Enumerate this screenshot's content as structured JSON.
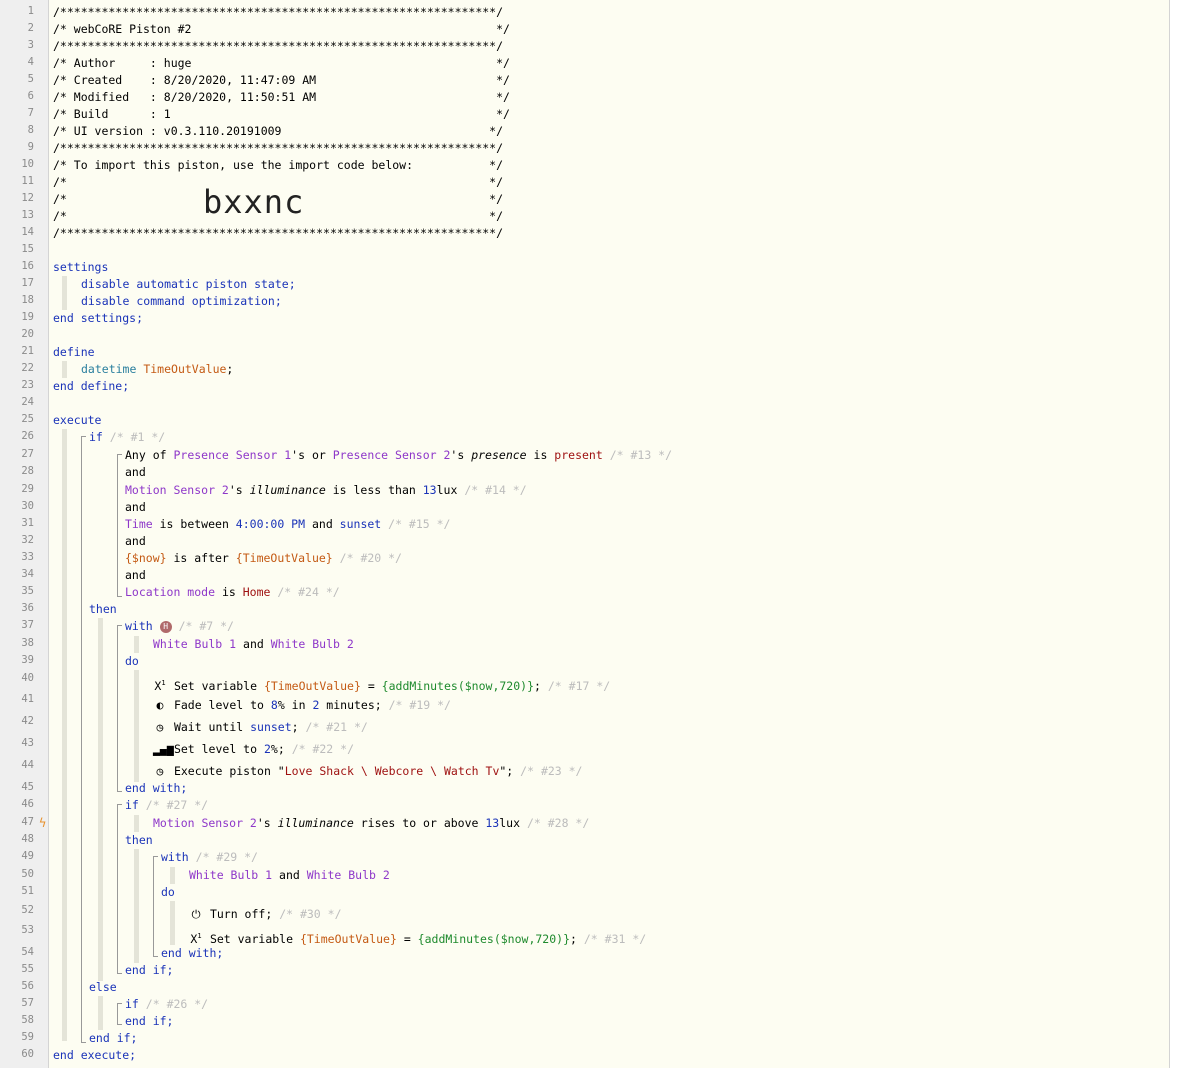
{
  "import_code": "bxxnc",
  "header": {
    "stars": "/***************************************************************/",
    "title": "/* webCoRE Piston #2                                            */",
    "author": "/* Author     : huge                                            */",
    "created": "/* Created    : 8/20/2020, 11:47:09 AM                          */",
    "modified": "/* Modified   : 8/20/2020, 11:50:51 AM                          */",
    "build": "/* Build      : 1                                               */",
    "ui_version": "/* UI version : v0.3.110.20191009                              */",
    "import_line": "/* To import this piston, use the import code below:           */",
    "blank": "/*                                                             */",
    "code_left": "/*               ",
    "code_right": "                               */"
  },
  "settings": {
    "open": "settings",
    "line1": "disable automatic piston state;",
    "line2": "disable command optimization;",
    "close": "end settings;"
  },
  "define": {
    "open": "define",
    "type": "datetime",
    "var": "TimeOutValue",
    "close": "end define;"
  },
  "execute": {
    "open": "execute",
    "close": "end execute;"
  },
  "words": {
    "if": "if",
    "then": "then",
    "else": "else",
    "and": "and",
    "with": "with",
    "do": "do",
    "end_with": "end with;",
    "end_if": "end if;"
  },
  "comments": {
    "c1": "/* #1 */",
    "c13": "/* #13 */",
    "c14": "/* #14 */",
    "c15": "/* #15 */",
    "c20": "/* #20 */",
    "c24": "/* #24 */",
    "c7": "/* #7 */",
    "c17": "/* #17 */",
    "c19": "/* #19 */",
    "c21": "/* #21 */",
    "c22": "/* #22 */",
    "c23": "/* #23 */",
    "c27": "/* #27 */",
    "c28": "/* #28 */",
    "c29": "/* #29 */",
    "c30": "/* #30 */",
    "c31": "/* #31 */",
    "c26": "/* #26 */"
  },
  "conditions": {
    "presence": {
      "any_of": "Any of ",
      "dev1": "Presence Sensor 1",
      "mid": "'s or ",
      "dev2": "Presence Sensor 2",
      "poss": "'s ",
      "attr": "presence",
      "is": " is ",
      "value": "present"
    },
    "illum": {
      "dev": "Motion Sensor 2",
      "poss": "'s ",
      "attr": "illuminance",
      "op": " is less than ",
      "num": "13",
      "unit": "lux"
    },
    "time": {
      "dev": "Time",
      "op": " is between ",
      "from": "4:00:00 PM",
      "and": " and ",
      "to": "sunset"
    },
    "now": {
      "left": "{$now}",
      "op": " is after ",
      "right": "{TimeOutValue}"
    },
    "mode": {
      "left": "Location mode",
      "op": " is ",
      "right": "Home"
    }
  },
  "with1": {
    "badge": "H",
    "dev1": "White Bulb 1",
    "and": " and ",
    "dev2": "White Bulb 2",
    "tasks": {
      "set_label": "Set variable ",
      "set_var": "{TimeOutValue}",
      "eq": " = ",
      "set_expr": "{addMinutes($now,720)}",
      "semi": ";",
      "fade_a": "Fade level to ",
      "fade_pct": "8",
      "fade_b": "% in ",
      "fade_min": "2",
      "fade_c": " minutes;",
      "wait_a": "Wait until ",
      "wait_b": "sunset",
      "wait_c": ";",
      "level_a": "Set level to ",
      "level_pct": "2",
      "level_b": "%;",
      "exec_a": "Execute piston ",
      "exec_q": "\"",
      "exec_name": "Love Shack \\ Webcore \\ Watch Tv",
      "exec_end": "\";"
    }
  },
  "if2": {
    "dev": "Motion Sensor 2",
    "poss": "'s ",
    "attr": "illuminance",
    "op": " rises to or above ",
    "num": "13",
    "unit": "lux"
  },
  "with2": {
    "dev1": "White Bulb 1",
    "and": " and ",
    "dev2": "White Bulb 2",
    "turn_off": "Turn off;"
  },
  "icons": {
    "variable": "variable-icon",
    "fade": "toggle-icon",
    "clock": "clock-icon",
    "signal": "signal-bars-icon",
    "power": "power-icon",
    "flash": "flash-icon"
  }
}
